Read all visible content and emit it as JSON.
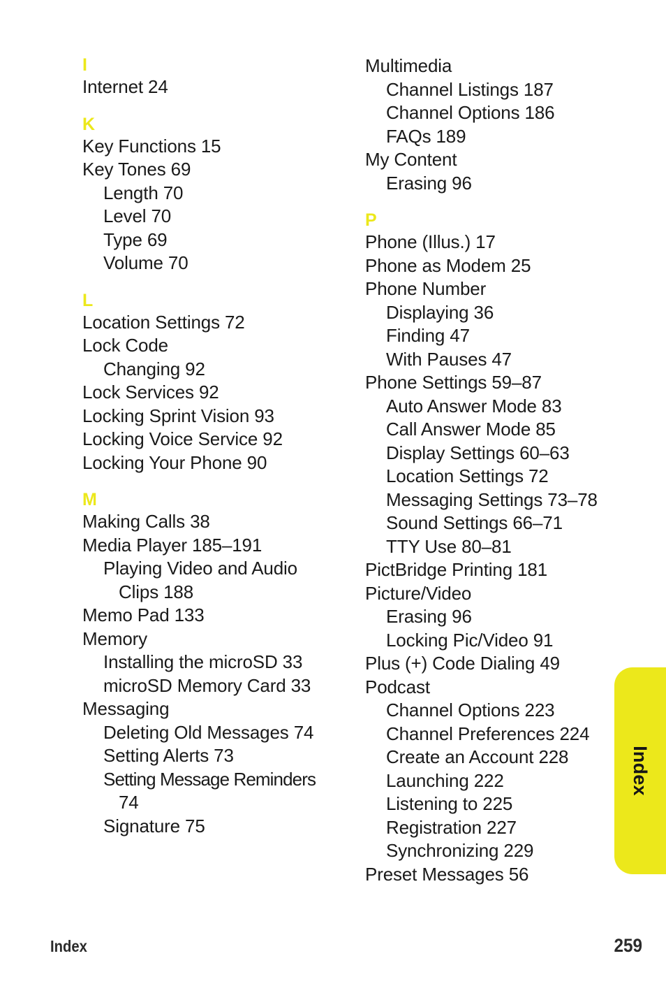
{
  "document": {
    "side_tab_label": "Index",
    "footer": {
      "section_label": "Index",
      "page_number": "259"
    },
    "accent_color": "#ece81b",
    "text_color": "#1a1a1a"
  },
  "columns": {
    "left": [
      {
        "type": "letter",
        "label": "I"
      },
      {
        "type": "entry",
        "level": 0,
        "text": "Internet  24"
      },
      {
        "type": "letter",
        "label": "K"
      },
      {
        "type": "entry",
        "level": 0,
        "text": "Key Functions  15"
      },
      {
        "type": "entry",
        "level": 0,
        "text": "Key Tones  69"
      },
      {
        "type": "entry",
        "level": 1,
        "text": "Length  70"
      },
      {
        "type": "entry",
        "level": 1,
        "text": "Level  70"
      },
      {
        "type": "entry",
        "level": 1,
        "text": "Type  69"
      },
      {
        "type": "entry",
        "level": 1,
        "text": "Volume  70"
      },
      {
        "type": "letter",
        "label": "L"
      },
      {
        "type": "entry",
        "level": 0,
        "text": "Location Settings  72"
      },
      {
        "type": "entry",
        "level": 0,
        "text": "Lock Code"
      },
      {
        "type": "entry",
        "level": 1,
        "text": "Changing  92"
      },
      {
        "type": "entry",
        "level": 0,
        "text": "Lock Services  92"
      },
      {
        "type": "entry",
        "level": 0,
        "text": "Locking Sprint Vision  93"
      },
      {
        "type": "entry",
        "level": 0,
        "text": "Locking Voice Service  92"
      },
      {
        "type": "entry",
        "level": 0,
        "text": "Locking Your Phone  90"
      },
      {
        "type": "letter",
        "label": "M"
      },
      {
        "type": "entry",
        "level": 0,
        "text": "Making Calls  38"
      },
      {
        "type": "entry",
        "level": 0,
        "text": "Media Player  185–191"
      },
      {
        "type": "entry",
        "level": 1,
        "text": "Playing Video and Audio"
      },
      {
        "type": "entry",
        "level": 2,
        "text": "Clips  188"
      },
      {
        "type": "entry",
        "level": 0,
        "text": "Memo Pad  133"
      },
      {
        "type": "entry",
        "level": 0,
        "text": "Memory"
      },
      {
        "type": "entry",
        "level": 1,
        "text": "Installing the microSD  33"
      },
      {
        "type": "entry",
        "level": 1,
        "text": "microSD Memory Card  33"
      },
      {
        "type": "entry",
        "level": 0,
        "text": "Messaging"
      },
      {
        "type": "entry",
        "level": 1,
        "text": "Deleting Old Messages  74"
      },
      {
        "type": "entry",
        "level": 1,
        "text": "Setting Alerts  73"
      },
      {
        "type": "entry",
        "level": 1,
        "tight": true,
        "text": "Setting Message Reminders"
      },
      {
        "type": "entry",
        "level": 2,
        "text": "74"
      },
      {
        "type": "entry",
        "level": 1,
        "text": "Signature  75"
      }
    ],
    "right": [
      {
        "type": "entry",
        "level": 0,
        "text": "Multimedia"
      },
      {
        "type": "entry",
        "level": 1,
        "text": "Channel Listings  187"
      },
      {
        "type": "entry",
        "level": 1,
        "text": "Channel Options  186"
      },
      {
        "type": "entry",
        "level": 1,
        "text": "FAQs  189"
      },
      {
        "type": "entry",
        "level": 0,
        "text": "My Content"
      },
      {
        "type": "entry",
        "level": 1,
        "text": "Erasing  96"
      },
      {
        "type": "letter",
        "label": "P"
      },
      {
        "type": "entry",
        "level": 0,
        "text": "Phone (Illus.)  17"
      },
      {
        "type": "entry",
        "level": 0,
        "text": "Phone as Modem  25"
      },
      {
        "type": "entry",
        "level": 0,
        "text": "Phone Number"
      },
      {
        "type": "entry",
        "level": 1,
        "text": "Displaying  36"
      },
      {
        "type": "entry",
        "level": 1,
        "text": "Finding  47"
      },
      {
        "type": "entry",
        "level": 1,
        "text": "With Pauses  47"
      },
      {
        "type": "entry",
        "level": 0,
        "text": "Phone Settings  59–87"
      },
      {
        "type": "entry",
        "level": 1,
        "text": "Auto Answer Mode  83"
      },
      {
        "type": "entry",
        "level": 1,
        "text": "Call Answer Mode  85"
      },
      {
        "type": "entry",
        "level": 1,
        "text": "Display Settings  60–63"
      },
      {
        "type": "entry",
        "level": 1,
        "text": "Location Settings  72"
      },
      {
        "type": "entry",
        "level": 1,
        "text": "Messaging Settings  73–78"
      },
      {
        "type": "entry",
        "level": 1,
        "text": "Sound Settings  66–71"
      },
      {
        "type": "entry",
        "level": 1,
        "text": "TTY Use  80–81"
      },
      {
        "type": "entry",
        "level": 0,
        "text": "PictBridge Printing  181"
      },
      {
        "type": "entry",
        "level": 0,
        "text": "Picture/Video"
      },
      {
        "type": "entry",
        "level": 1,
        "text": "Erasing  96"
      },
      {
        "type": "entry",
        "level": 1,
        "text": "Locking Pic/Video  91"
      },
      {
        "type": "entry",
        "level": 0,
        "text": "Plus (+) Code Dialing  49"
      },
      {
        "type": "entry",
        "level": 0,
        "text": "Podcast"
      },
      {
        "type": "entry",
        "level": 1,
        "text": "Channel Options  223"
      },
      {
        "type": "entry",
        "level": 1,
        "text": "Channel Preferences  224"
      },
      {
        "type": "entry",
        "level": 1,
        "text": "Create an Account  228"
      },
      {
        "type": "entry",
        "level": 1,
        "text": "Launching  222"
      },
      {
        "type": "entry",
        "level": 1,
        "text": "Listening to  225"
      },
      {
        "type": "entry",
        "level": 1,
        "text": "Registration  227"
      },
      {
        "type": "entry",
        "level": 1,
        "text": "Synchronizing  229"
      },
      {
        "type": "entry",
        "level": 0,
        "text": "Preset Messages  56"
      }
    ]
  }
}
